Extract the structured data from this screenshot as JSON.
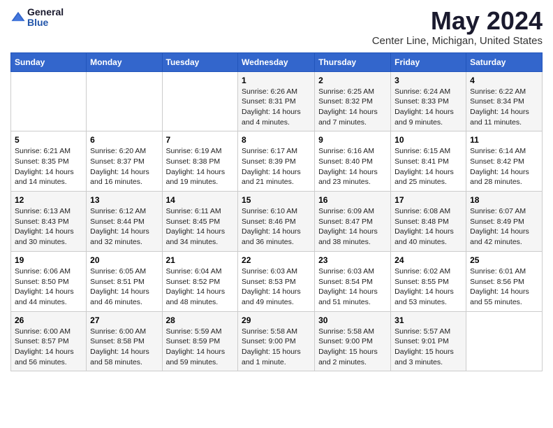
{
  "logo": {
    "general": "General",
    "blue": "Blue"
  },
  "title": "May 2024",
  "subtitle": "Center Line, Michigan, United States",
  "days_of_week": [
    "Sunday",
    "Monday",
    "Tuesday",
    "Wednesday",
    "Thursday",
    "Friday",
    "Saturday"
  ],
  "weeks": [
    [
      {
        "day": "",
        "info": ""
      },
      {
        "day": "",
        "info": ""
      },
      {
        "day": "",
        "info": ""
      },
      {
        "day": "1",
        "info": "Sunrise: 6:26 AM\nSunset: 8:31 PM\nDaylight: 14 hours and 4 minutes."
      },
      {
        "day": "2",
        "info": "Sunrise: 6:25 AM\nSunset: 8:32 PM\nDaylight: 14 hours and 7 minutes."
      },
      {
        "day": "3",
        "info": "Sunrise: 6:24 AM\nSunset: 8:33 PM\nDaylight: 14 hours and 9 minutes."
      },
      {
        "day": "4",
        "info": "Sunrise: 6:22 AM\nSunset: 8:34 PM\nDaylight: 14 hours and 11 minutes."
      }
    ],
    [
      {
        "day": "5",
        "info": "Sunrise: 6:21 AM\nSunset: 8:35 PM\nDaylight: 14 hours and 14 minutes."
      },
      {
        "day": "6",
        "info": "Sunrise: 6:20 AM\nSunset: 8:37 PM\nDaylight: 14 hours and 16 minutes."
      },
      {
        "day": "7",
        "info": "Sunrise: 6:19 AM\nSunset: 8:38 PM\nDaylight: 14 hours and 19 minutes."
      },
      {
        "day": "8",
        "info": "Sunrise: 6:17 AM\nSunset: 8:39 PM\nDaylight: 14 hours and 21 minutes."
      },
      {
        "day": "9",
        "info": "Sunrise: 6:16 AM\nSunset: 8:40 PM\nDaylight: 14 hours and 23 minutes."
      },
      {
        "day": "10",
        "info": "Sunrise: 6:15 AM\nSunset: 8:41 PM\nDaylight: 14 hours and 25 minutes."
      },
      {
        "day": "11",
        "info": "Sunrise: 6:14 AM\nSunset: 8:42 PM\nDaylight: 14 hours and 28 minutes."
      }
    ],
    [
      {
        "day": "12",
        "info": "Sunrise: 6:13 AM\nSunset: 8:43 PM\nDaylight: 14 hours and 30 minutes."
      },
      {
        "day": "13",
        "info": "Sunrise: 6:12 AM\nSunset: 8:44 PM\nDaylight: 14 hours and 32 minutes."
      },
      {
        "day": "14",
        "info": "Sunrise: 6:11 AM\nSunset: 8:45 PM\nDaylight: 14 hours and 34 minutes."
      },
      {
        "day": "15",
        "info": "Sunrise: 6:10 AM\nSunset: 8:46 PM\nDaylight: 14 hours and 36 minutes."
      },
      {
        "day": "16",
        "info": "Sunrise: 6:09 AM\nSunset: 8:47 PM\nDaylight: 14 hours and 38 minutes."
      },
      {
        "day": "17",
        "info": "Sunrise: 6:08 AM\nSunset: 8:48 PM\nDaylight: 14 hours and 40 minutes."
      },
      {
        "day": "18",
        "info": "Sunrise: 6:07 AM\nSunset: 8:49 PM\nDaylight: 14 hours and 42 minutes."
      }
    ],
    [
      {
        "day": "19",
        "info": "Sunrise: 6:06 AM\nSunset: 8:50 PM\nDaylight: 14 hours and 44 minutes."
      },
      {
        "day": "20",
        "info": "Sunrise: 6:05 AM\nSunset: 8:51 PM\nDaylight: 14 hours and 46 minutes."
      },
      {
        "day": "21",
        "info": "Sunrise: 6:04 AM\nSunset: 8:52 PM\nDaylight: 14 hours and 48 minutes."
      },
      {
        "day": "22",
        "info": "Sunrise: 6:03 AM\nSunset: 8:53 PM\nDaylight: 14 hours and 49 minutes."
      },
      {
        "day": "23",
        "info": "Sunrise: 6:03 AM\nSunset: 8:54 PM\nDaylight: 14 hours and 51 minutes."
      },
      {
        "day": "24",
        "info": "Sunrise: 6:02 AM\nSunset: 8:55 PM\nDaylight: 14 hours and 53 minutes."
      },
      {
        "day": "25",
        "info": "Sunrise: 6:01 AM\nSunset: 8:56 PM\nDaylight: 14 hours and 55 minutes."
      }
    ],
    [
      {
        "day": "26",
        "info": "Sunrise: 6:00 AM\nSunset: 8:57 PM\nDaylight: 14 hours and 56 minutes."
      },
      {
        "day": "27",
        "info": "Sunrise: 6:00 AM\nSunset: 8:58 PM\nDaylight: 14 hours and 58 minutes."
      },
      {
        "day": "28",
        "info": "Sunrise: 5:59 AM\nSunset: 8:59 PM\nDaylight: 14 hours and 59 minutes."
      },
      {
        "day": "29",
        "info": "Sunrise: 5:58 AM\nSunset: 9:00 PM\nDaylight: 15 hours and 1 minute."
      },
      {
        "day": "30",
        "info": "Sunrise: 5:58 AM\nSunset: 9:00 PM\nDaylight: 15 hours and 2 minutes."
      },
      {
        "day": "31",
        "info": "Sunrise: 5:57 AM\nSunset: 9:01 PM\nDaylight: 15 hours and 3 minutes."
      },
      {
        "day": "",
        "info": ""
      }
    ]
  ]
}
